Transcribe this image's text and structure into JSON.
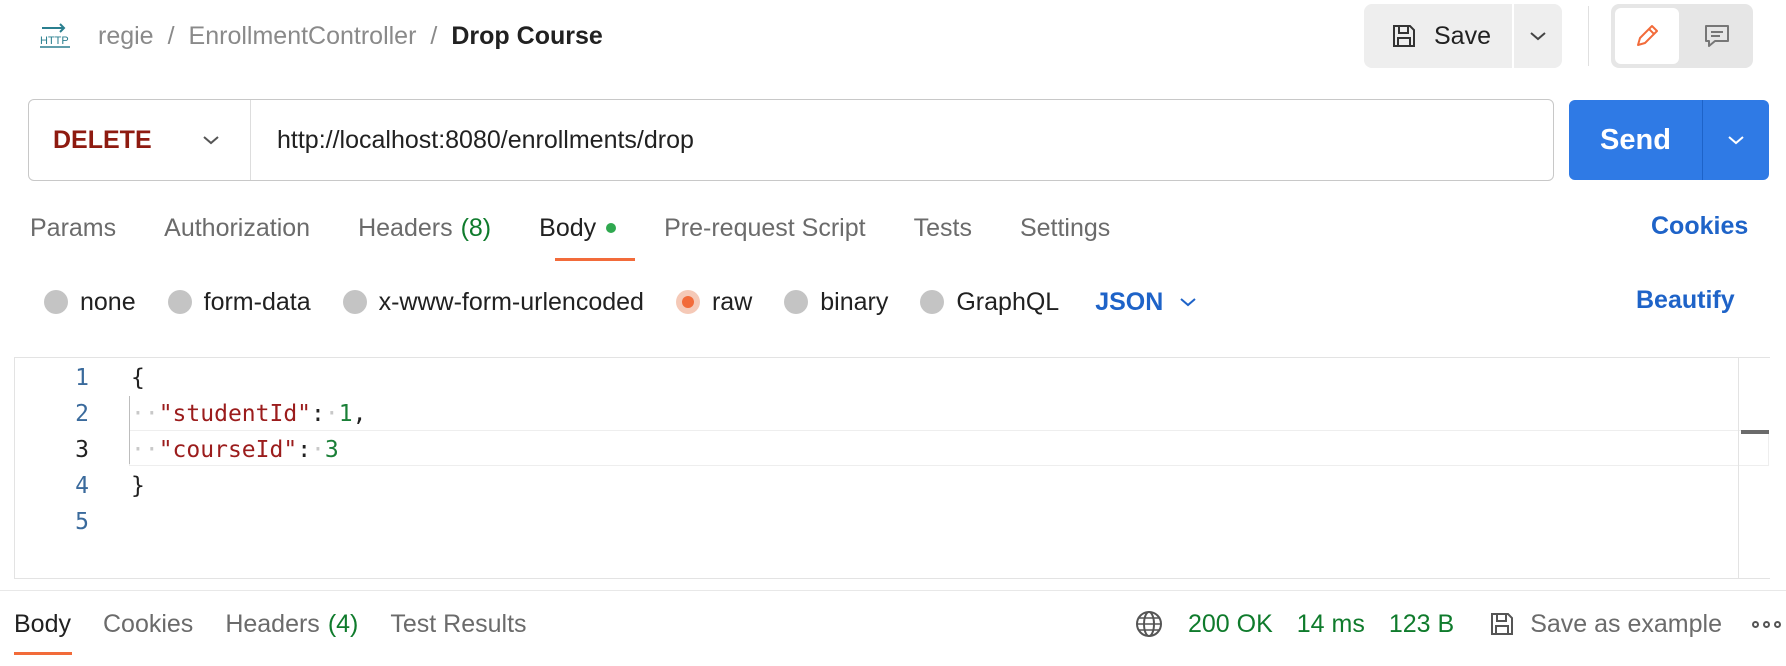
{
  "header": {
    "protocol_icon": "http-icon",
    "breadcrumb": [
      "regie",
      "EnrollmentController",
      "Drop Course"
    ],
    "save_label": "Save"
  },
  "request": {
    "method": "DELETE",
    "url": "http://localhost:8080/enrollments/drop",
    "send_label": "Send"
  },
  "tabs": {
    "params": "Params",
    "authorization": "Authorization",
    "headers": "Headers",
    "headers_count": "(8)",
    "body": "Body",
    "pre_request": "Pre-request Script",
    "tests": "Tests",
    "settings": "Settings",
    "active": "Body",
    "cookies_link": "Cookies"
  },
  "body_types": {
    "options": [
      "none",
      "form-data",
      "x-www-form-urlencoded",
      "raw",
      "binary",
      "GraphQL"
    ],
    "selected": "raw",
    "format": "JSON",
    "beautify": "Beautify"
  },
  "editor": {
    "line_numbers": [
      "1",
      "2",
      "3",
      "4",
      "5"
    ],
    "open_brace": "{",
    "close_brace": "}",
    "key_student": "\"studentId\"",
    "val_student": "1",
    "key_course": "\"courseId\"",
    "val_course": "3"
  },
  "response": {
    "tabs": {
      "body": "Body",
      "cookies": "Cookies",
      "headers": "Headers",
      "headers_count": "(4)",
      "test_results": "Test Results"
    },
    "status": "200 OK",
    "time": "14 ms",
    "size": "123 B",
    "save_example": "Save as example"
  },
  "colors": {
    "accent": "#f26b3a",
    "primary": "#2f7ae5",
    "link": "#1e63c8",
    "method_delete": "#8e1a10",
    "success": "#0f7b2c"
  }
}
